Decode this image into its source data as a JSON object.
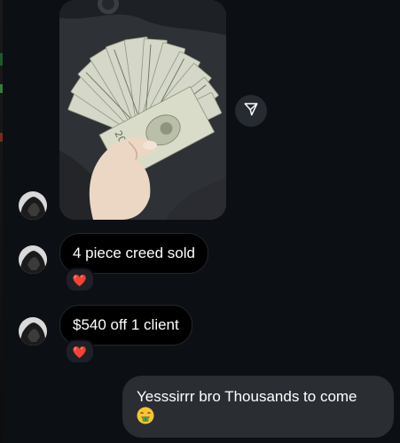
{
  "thread": {
    "messages": [
      {
        "type": "image",
        "sender": "other",
        "alt": "hand holding a fan of $20 bills"
      },
      {
        "type": "text",
        "sender": "other",
        "text": "4 piece creed sold",
        "reaction": "❤️"
      },
      {
        "type": "text",
        "sender": "other",
        "text": "$540 off 1 client",
        "reaction": "❤️"
      },
      {
        "type": "text",
        "sender": "me",
        "text": "Yesssirrr bro Thousands to come",
        "emoji": "money-mouth-face"
      }
    ]
  },
  "icons": {
    "share": "paper-plane-icon",
    "avatar": "profile-avatar"
  },
  "colors": {
    "background": "#0c0f14",
    "incoming_bubble": "#000000",
    "outgoing_bubble": "#2a2d32",
    "reaction_bg": "#1d2026",
    "heart": "#e0245e"
  }
}
